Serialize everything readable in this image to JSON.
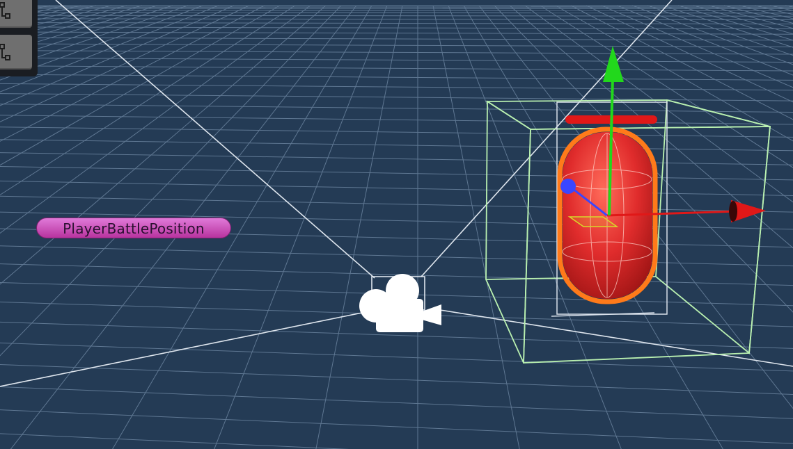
{
  "scene": {
    "background_color": "#243b55",
    "grid_color": "#8fa8c4",
    "frustum_color": "#dfe6ee",
    "selection_box_color": "#b9f0b0",
    "capsule_color": "#e03030",
    "outline_color": "#ff7a1a"
  },
  "toolbar": {
    "buttons": [
      {
        "icon": "node-hierarchy-icon"
      },
      {
        "icon": "node-hierarchy-icon"
      }
    ]
  },
  "gizmo": {
    "x_axis_color": "#e01818",
    "y_axis_color": "#22d81c",
    "z_axis_color": "#3a46ff"
  },
  "labels": {
    "position_marker": "PlayerBattlePosition"
  },
  "icons": {
    "camera": "camera-icon"
  }
}
